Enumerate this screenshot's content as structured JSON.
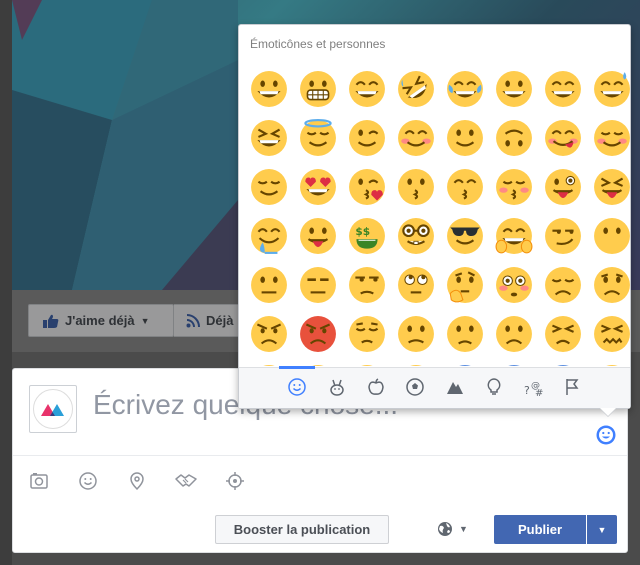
{
  "background_page": {
    "like_button": "J'aime déjà",
    "follow_button": "Déjà"
  },
  "emoji_picker": {
    "section_title": "Émoticônes et personnes",
    "emojis": [
      "grinning",
      "grimacing",
      "grin",
      "rofl",
      "joy",
      "smiley",
      "smile",
      "sweat-smile",
      "laughing",
      "innocent",
      "wink",
      "blush",
      "slight-smile",
      "upside-down",
      "yum",
      "relieved",
      "relieved-closed",
      "heart-eyes",
      "kissing-heart",
      "kissing",
      "kissing-smiling-eyes",
      "kissing-closed-eyes",
      "stuck-out-tongue-wink",
      "stuck-out-tongue-closed",
      "drooling",
      "stuck-out-tongue",
      "money-mouth",
      "nerd",
      "sunglasses",
      "hugging",
      "smirk",
      "no-mouth",
      "neutral",
      "expressionless",
      "unamused",
      "rolling-eyes",
      "thinking",
      "flushed",
      "disappointed",
      "worried",
      "angry",
      "rage",
      "pensive",
      "confused",
      "slight-frown",
      "frowning",
      "persevere",
      "confounded"
    ],
    "categories": [
      "smileys-people",
      "animals-nature",
      "food-drink",
      "activity",
      "travel-places",
      "objects",
      "symbols",
      "flags"
    ],
    "active_category": "smileys-people"
  },
  "composer": {
    "placeholder": "Écrivez quelque chose...",
    "tools": [
      "photo-video",
      "feeling",
      "check-in",
      "tag-sponsor",
      "target-audience"
    ],
    "boost_label": "Booster la publication",
    "publish_label": "Publier",
    "colors": {
      "primary": "#4267b2",
      "emoji_yellow": "#ffcc4d",
      "accent_blue": "#4080ff"
    }
  }
}
